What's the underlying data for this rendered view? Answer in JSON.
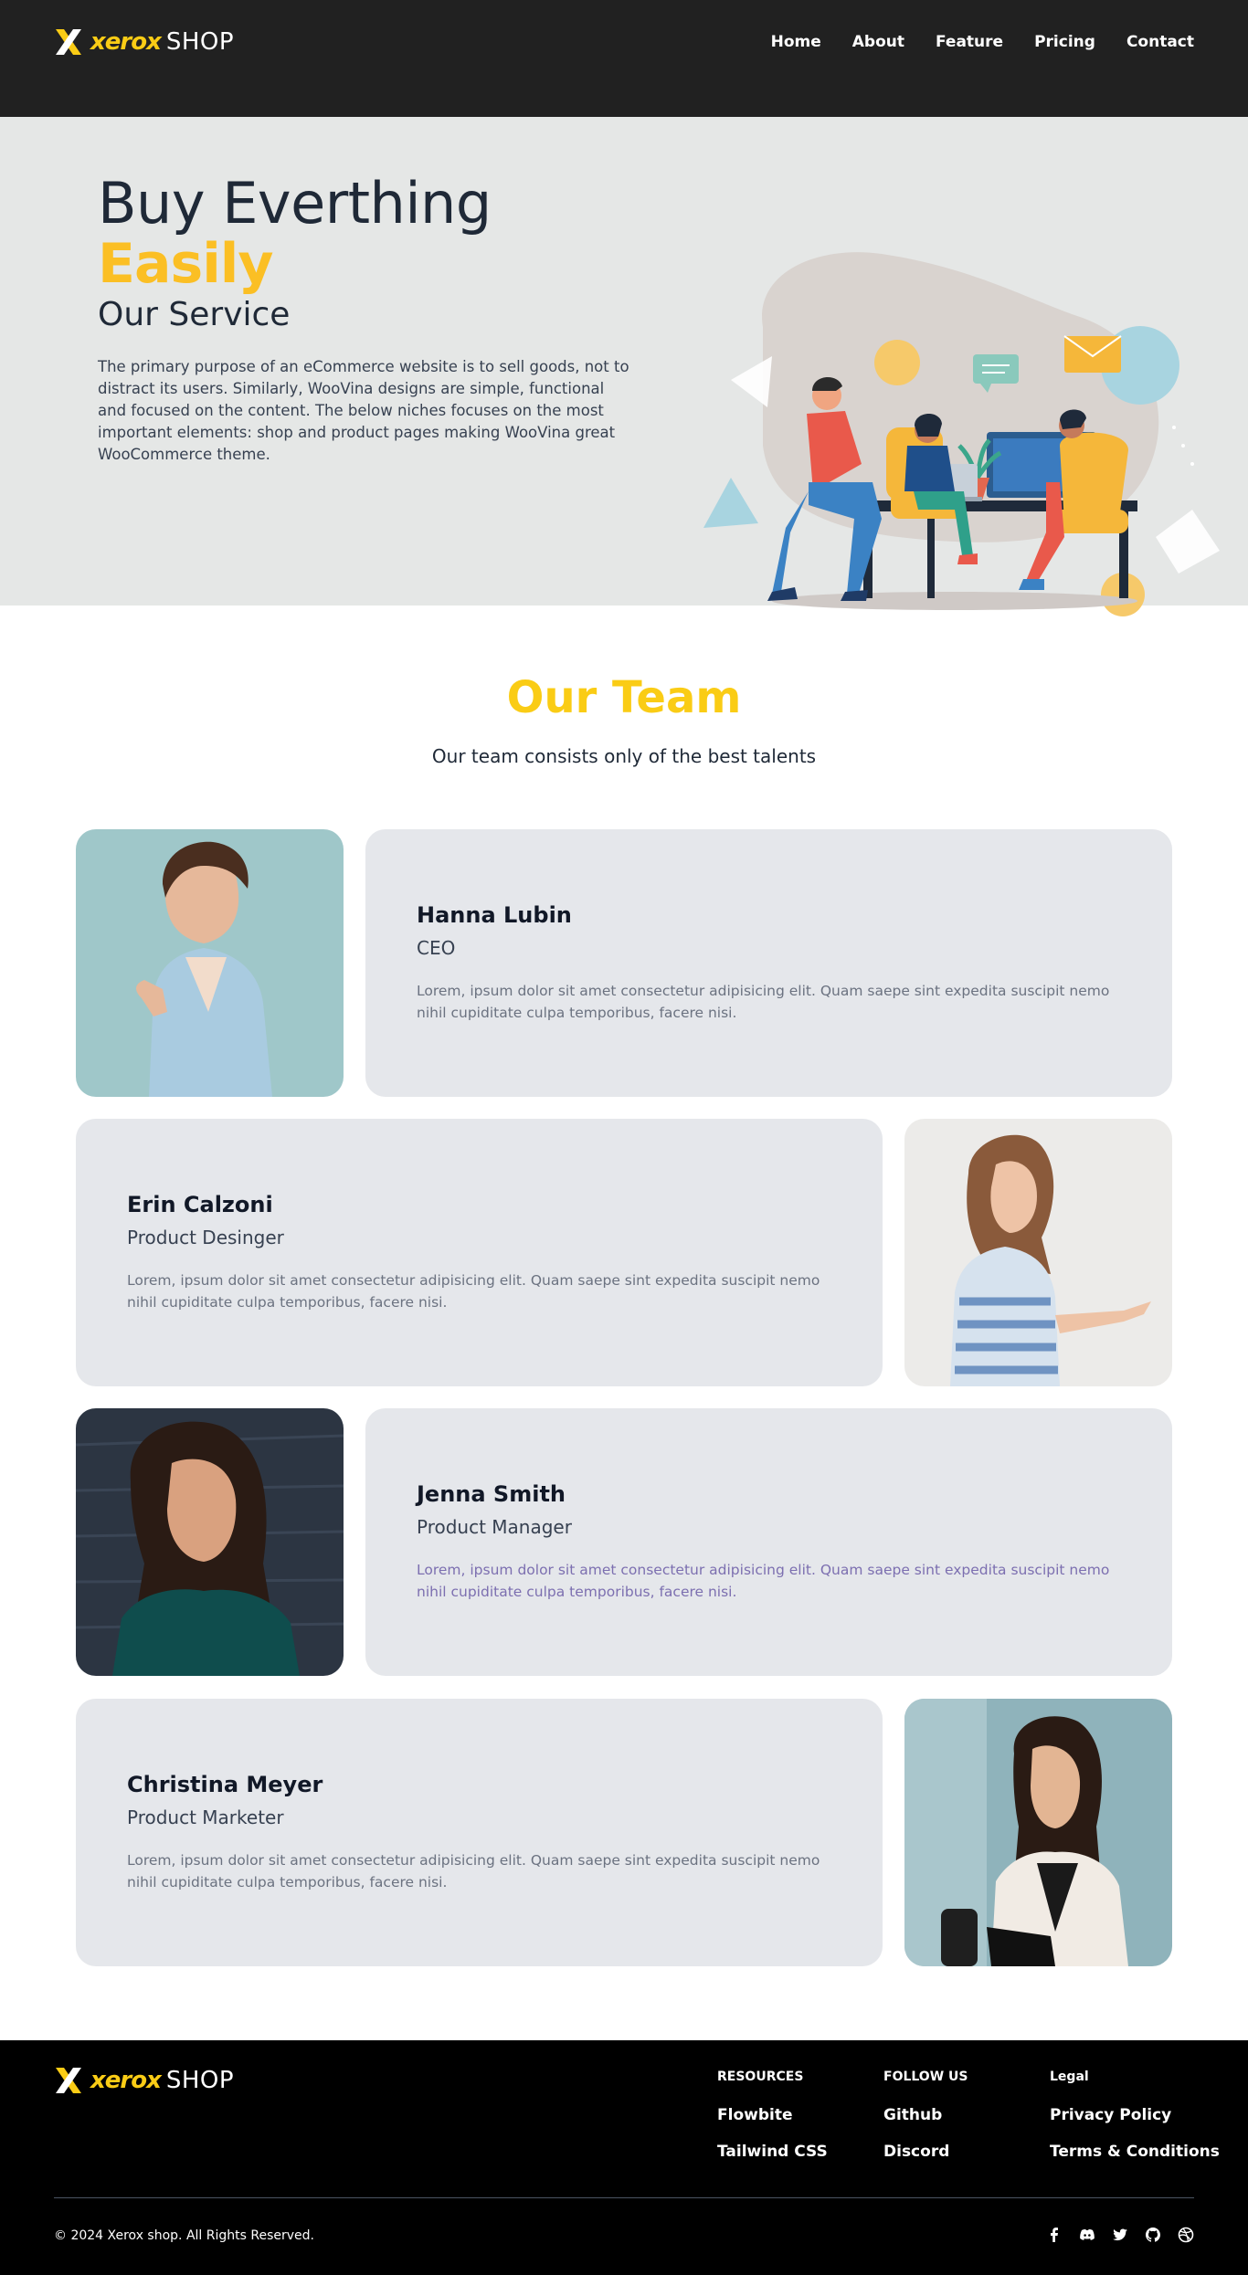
{
  "brand": {
    "name": "xerox",
    "suffix": "SHOP"
  },
  "nav": [
    "Home",
    "About",
    "Feature",
    "Pricing",
    "Contact"
  ],
  "hero": {
    "title": "Buy Everthing",
    "accent": "Easily",
    "subtitle": "Our Service",
    "text": "The primary purpose of an eCommerce website is to sell goods, not to distract its users. Similarly, WooVina designs are simple, functional and focused on the content. The below niches focuses on the most important elements: shop and product pages making WooVina great WooCommerce theme."
  },
  "team": {
    "title": "Our Team",
    "subtitle": "Our team consists only of the best talents",
    "members": [
      {
        "name": "Hanna Lubin",
        "role": "CEO",
        "desc": "Lorem, ipsum dolor sit amet consectetur adipisicing elit. Quam saepe sint expedita suscipit nemo nihil cupiditate culpa temporibus, facere nisi."
      },
      {
        "name": "Erin Calzoni",
        "role": "Product Desinger",
        "desc": "Lorem, ipsum dolor sit amet consectetur adipisicing elit. Quam saepe sint expedita suscipit nemo nihil cupiditate culpa temporibus, facere nisi."
      },
      {
        "name": "Jenna Smith",
        "role": "Product Manager",
        "desc": "Lorem, ipsum dolor sit amet consectetur adipisicing elit. Quam saepe sint expedita suscipit nemo nihil cupiditate culpa temporibus, facere nisi."
      },
      {
        "name": "Christina Meyer",
        "role": "Product Marketer",
        "desc": "Lorem, ipsum dolor sit amet consectetur adipisicing elit. Quam saepe sint expedita suscipit nemo nihil cupiditate culpa temporibus, facere nisi."
      }
    ]
  },
  "footer": {
    "resources": {
      "heading": "RESOURCES",
      "links": [
        "Flowbite",
        "Tailwind CSS"
      ]
    },
    "follow": {
      "heading": "FOLLOW US",
      "links": [
        "Github",
        "Discord"
      ]
    },
    "legal": {
      "heading": "Legal",
      "links": [
        "Privacy Policy",
        "Terms & Conditions"
      ]
    },
    "copyright": "© 2024 Xerox shop. All Rights Reserved.",
    "social_icons": [
      "facebook-icon",
      "discord-icon",
      "twitter-icon",
      "github-icon",
      "dribbble-icon"
    ]
  },
  "colors": {
    "accent": "#facc15",
    "accent_orange": "#fbbf24",
    "header_bg": "#212121",
    "hero_bg": "#e5e7e6",
    "card_bg": "#e5e7eb",
    "footer_bg": "#000000"
  }
}
